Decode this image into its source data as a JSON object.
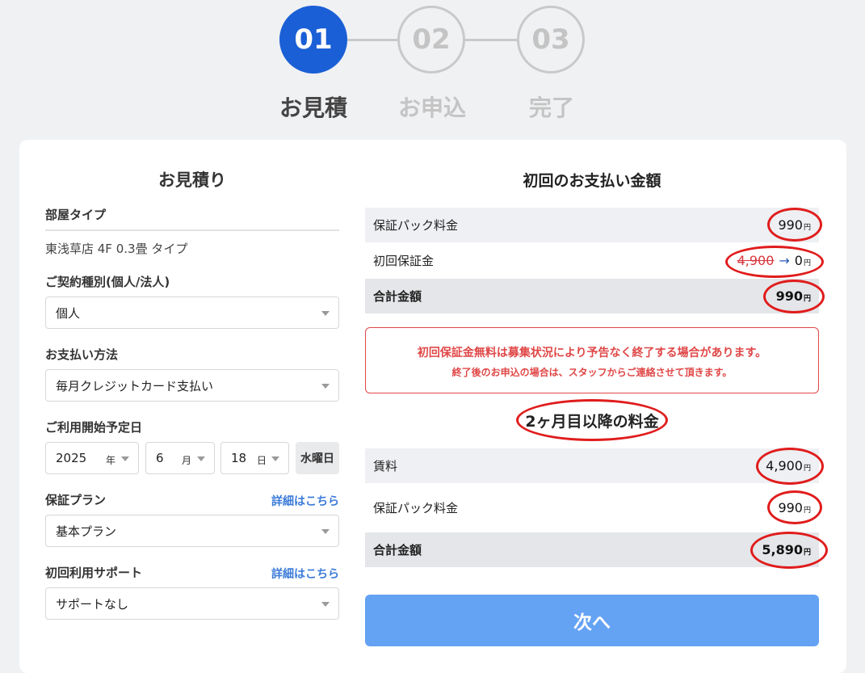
{
  "stepper": {
    "steps": [
      {
        "number": "01",
        "label": "お見積"
      },
      {
        "number": "02",
        "label": "お申込"
      },
      {
        "number": "03",
        "label": "完了"
      }
    ]
  },
  "estimate": {
    "title": "お見積り",
    "room_type_label": "部屋タイプ",
    "room_type_value": "東浅草店 4F 0.3畳 タイプ",
    "contract_type_label": "ご契約種別(個人/法人)",
    "contract_type_value": "個人",
    "payment_method_label": "お支払い方法",
    "payment_method_value": "毎月クレジットカード支払い",
    "start_date_label": "ご利用開始予定日",
    "year_value": "2025",
    "year_unit": "年",
    "month_value": "6",
    "month_unit": "月",
    "day_value": "18",
    "day_unit": "日",
    "weekday": "水曜日",
    "guarantee_plan_label": "保証プラン",
    "guarantee_plan_value": "基本プラン",
    "support_label": "初回利用サポート",
    "support_value": "サポートなし",
    "detail_link": "詳細はこちら"
  },
  "first_payment": {
    "title": "初回のお支払い金額",
    "rows": [
      {
        "label": "保証パック料金",
        "amount": "990"
      },
      {
        "label": "初回保証金",
        "old_amount": "4,900",
        "arrow": "→",
        "amount": "0"
      }
    ],
    "total_label": "合計金額",
    "total_amount": "990"
  },
  "yen_unit": "円",
  "notice": {
    "line1": "初回保証金無料は募集状況により予告なく終了する場合があります。",
    "line2": "終了後のお申込の場合は、スタッフからご連絡させて頂きます。"
  },
  "monthly": {
    "title": "2ヶ月目以降の料金",
    "rows": [
      {
        "label": "賃料",
        "amount": "4,900"
      },
      {
        "label": "保証パック料金",
        "amount": "990"
      }
    ],
    "total_label": "合計金額",
    "total_amount": "5,890"
  },
  "next_button": "次へ",
  "colors": {
    "primary": "#1a5fd6",
    "button": "#64a2f4",
    "annotation": "#e01c1c",
    "notice": "#e04747"
  }
}
